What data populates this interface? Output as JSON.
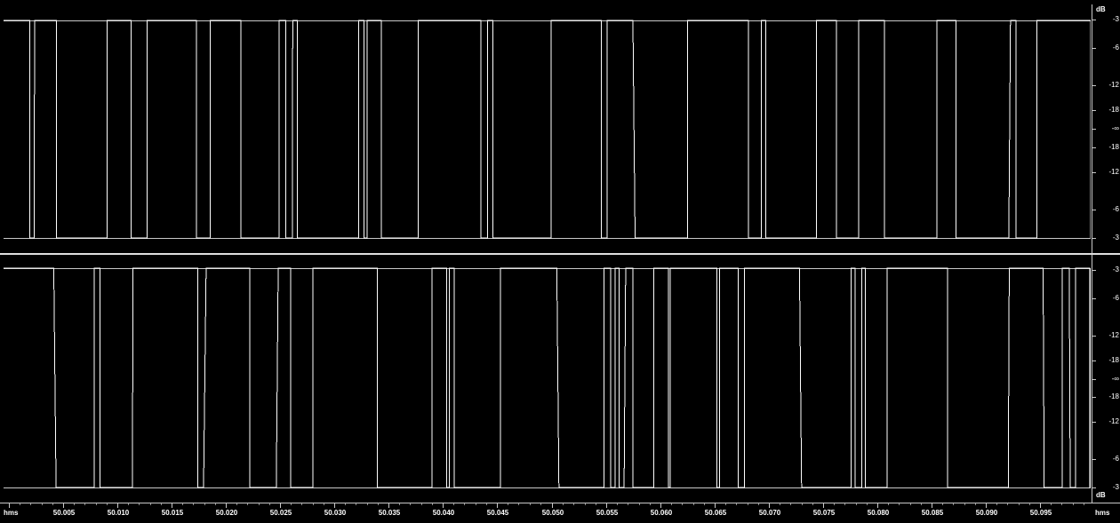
{
  "db_ruler": {
    "unit_label": "dB",
    "labels_top": [
      "-3",
      "-6",
      "-12",
      "-18",
      "-∞",
      "-18",
      "-12",
      "-6",
      "-3"
    ],
    "labels_bottom": [
      "-3",
      "-6",
      "-12",
      "-18",
      "-∞",
      "-18",
      "-12",
      "-6",
      "-3"
    ]
  },
  "timeline": {
    "unit_left": "hms",
    "unit_right": "hms",
    "labels": [
      "50.005",
      "50.010",
      "50.015",
      "50.020",
      "50.025",
      "50.030",
      "50.035",
      "50.040",
      "50.045",
      "50.050",
      "50.055",
      "50.060",
      "50.065",
      "50.070",
      "50.075",
      "50.080",
      "50.085",
      "50.090",
      "50.095"
    ]
  },
  "colors": {
    "background": "#000000",
    "waveform": "#ffffff",
    "grid": "#c8c8c8"
  }
}
